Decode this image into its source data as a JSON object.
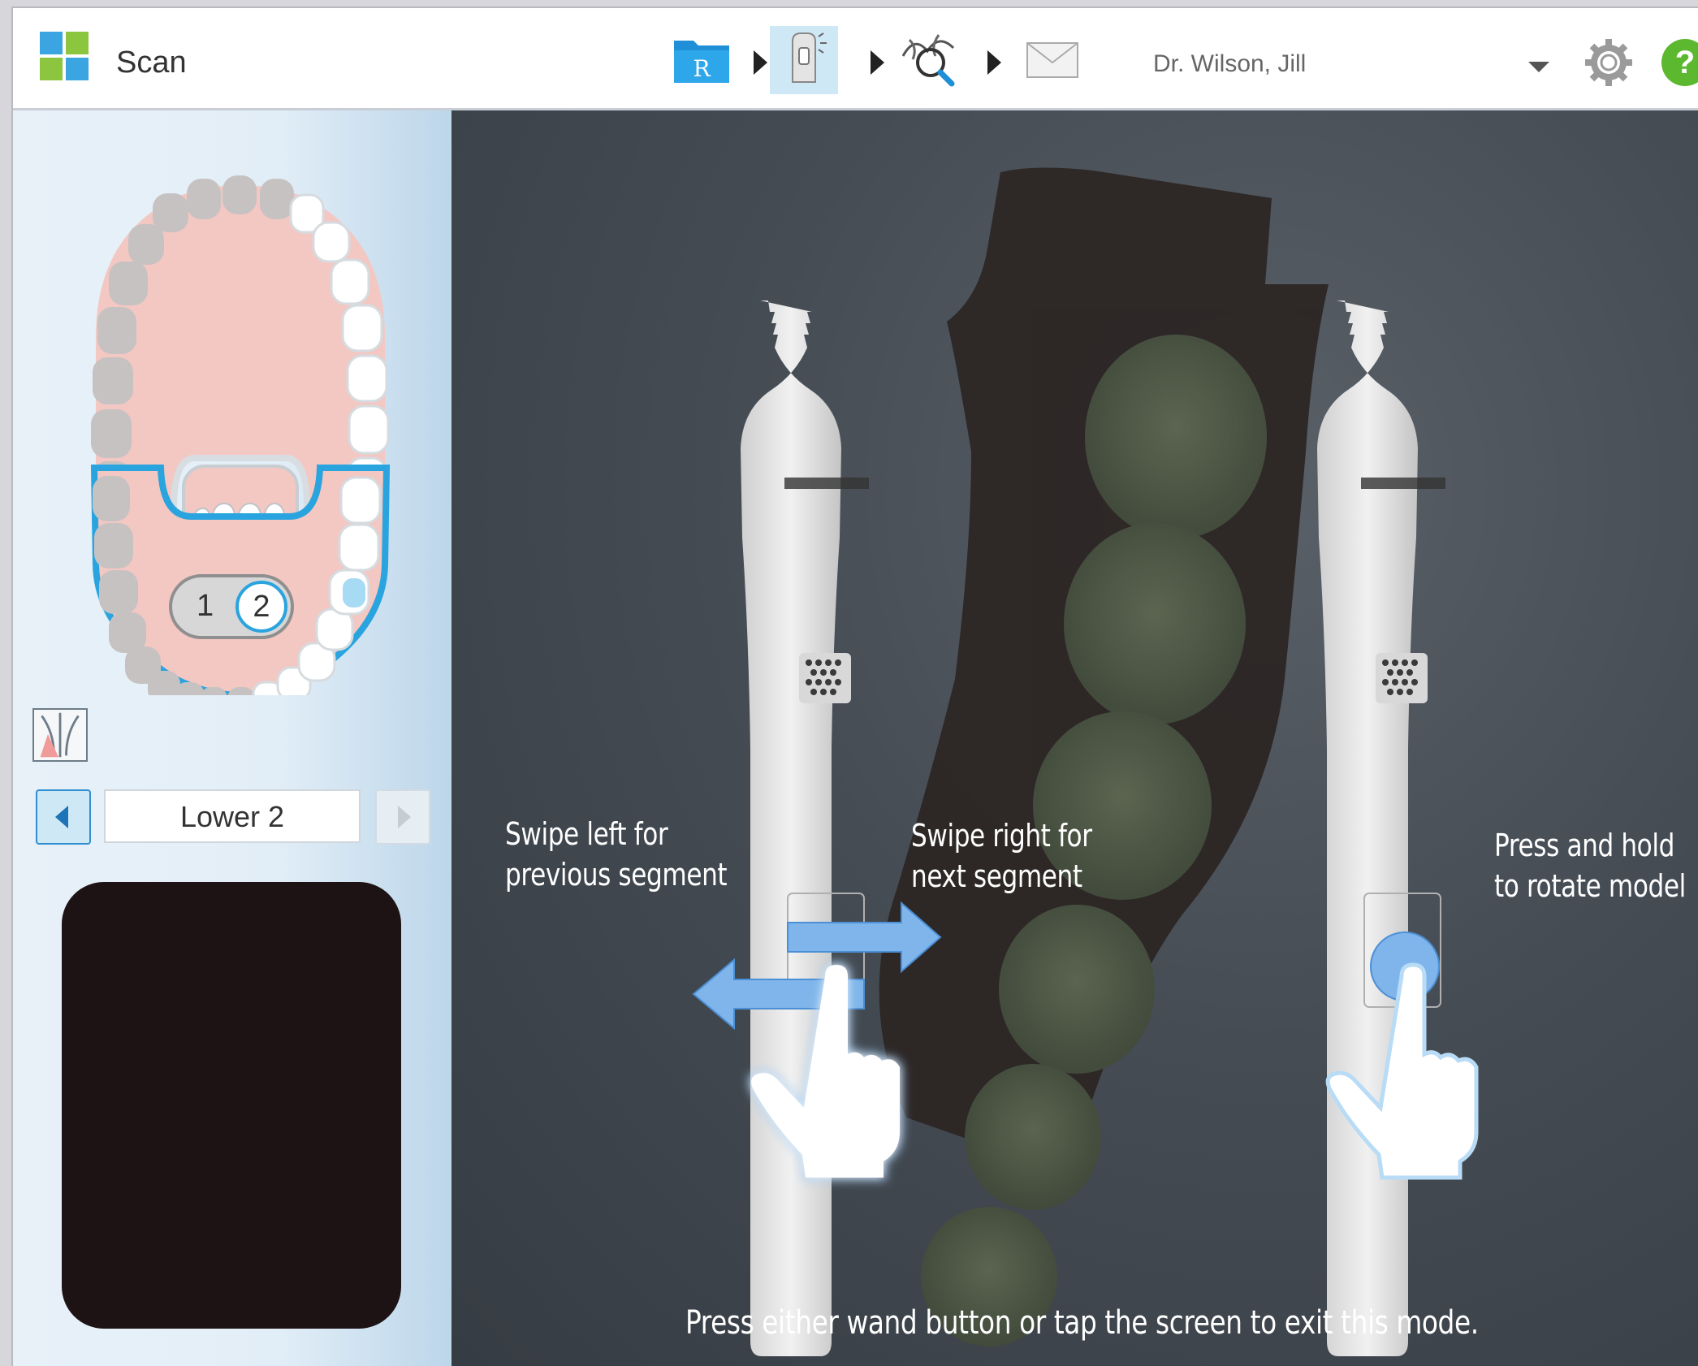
{
  "header": {
    "title": "Scan",
    "workflow_steps": [
      {
        "name": "rx-step",
        "icon": "rx-folder-icon",
        "label": "R"
      },
      {
        "name": "scan-step",
        "icon": "wand-icon",
        "active": true
      },
      {
        "name": "view-step",
        "icon": "view-magnify-icon"
      },
      {
        "name": "send-step",
        "icon": "envelope-icon"
      }
    ],
    "doctor": "Dr. Wilson, Jill"
  },
  "sidebar": {
    "segment_toggle": {
      "left": "1",
      "right": "2"
    },
    "segment_name": "Lower 2"
  },
  "instructions": {
    "swipe_left_line1": "Swipe left for",
    "swipe_left_line2": "previous segment",
    "swipe_right_line1": "Swipe right for",
    "swipe_right_line2": "next segment",
    "hold_line1": "Press and hold",
    "hold_line2": "to rotate model",
    "exit_hint": "Press either wand button or tap the screen to exit this mode."
  },
  "colors": {
    "accent": "#2aa4de",
    "gum": "#f3c7c2",
    "help": "#5cb82e"
  }
}
